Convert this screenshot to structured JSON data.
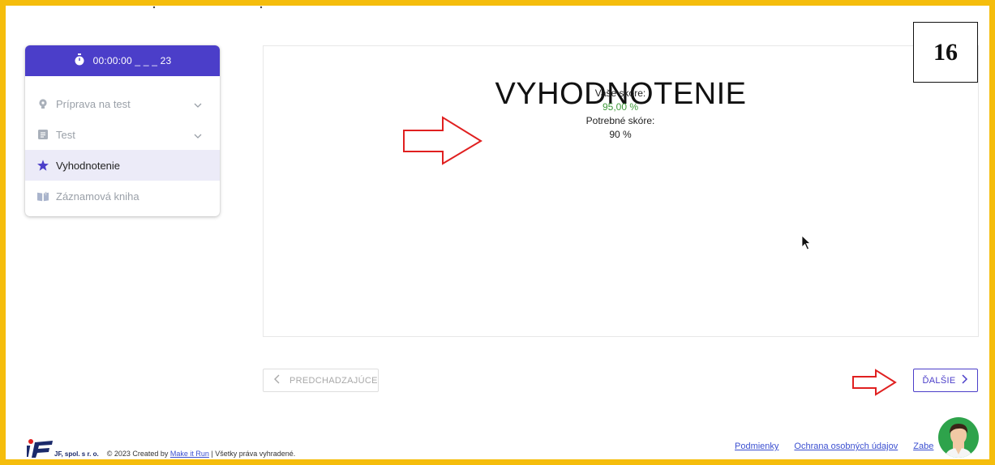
{
  "sidebar": {
    "timer": "00:00:00 _ _ _ 23",
    "items": [
      {
        "label": "Príprava na test",
        "icon": "lightbulb-icon",
        "expandable": true
      },
      {
        "label": "Test",
        "icon": "document-icon",
        "expandable": true
      },
      {
        "label": "Vyhodnotenie",
        "icon": "star-icon",
        "active": true
      },
      {
        "label": "Záznamová kniha",
        "icon": "book-icon"
      }
    ]
  },
  "main": {
    "title": "VYHODNOTENIE",
    "score_label": "Vaše skóre:",
    "score_value": "95,00 %",
    "required_label": "Potrebné skóre:",
    "required_value": "90 %"
  },
  "badge": "16",
  "nav": {
    "prev_label": "PREDCHADZAJÚCE",
    "next_label": "ĎALŠIE"
  },
  "footer": {
    "logo_text": "JF, spol. s r. o.",
    "copyright_prefix": "© 2023 Created by ",
    "copyright_link": "Make it Run",
    "copyright_suffix": " | Všetky práva vyhradené.",
    "links": [
      "Podmienky",
      "Ochrana osobných údajov",
      "Zabe"
    ],
    "link_tail": "e"
  },
  "colors": {
    "accent": "#4b3ec9",
    "frame": "#f5bd0c",
    "score_green": "#3f9a3a",
    "annotation_red": "#e02020"
  }
}
